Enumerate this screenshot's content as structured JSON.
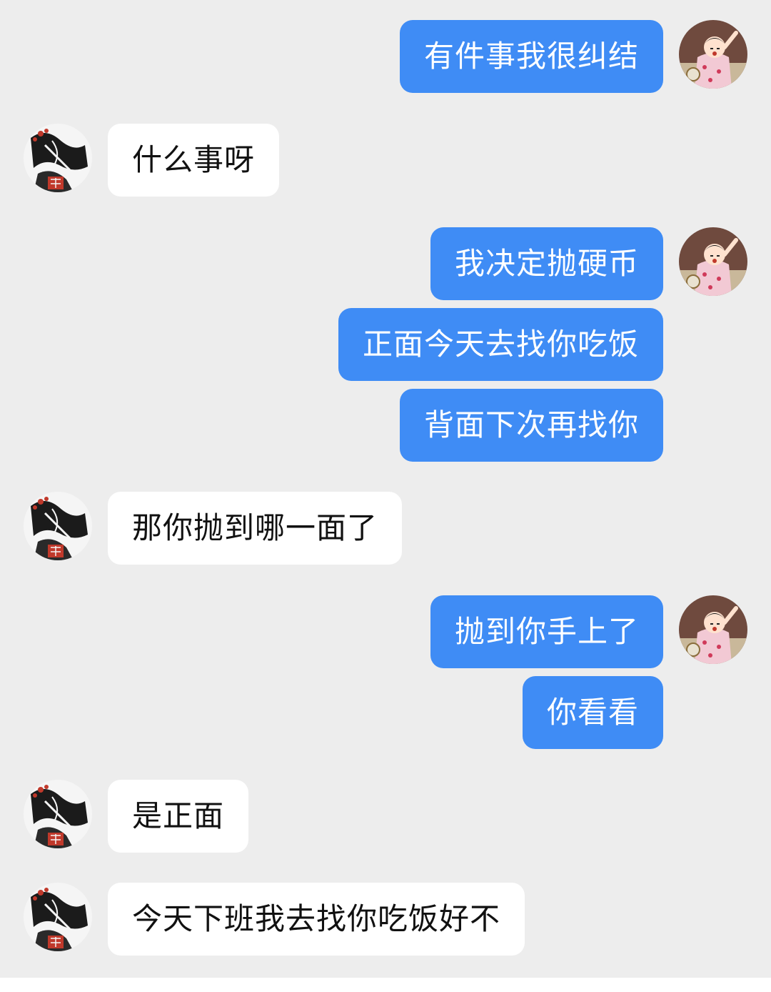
{
  "conversation": {
    "messages": [
      {
        "side": "out",
        "text": "有件事我很纠结"
      },
      {
        "side": "in",
        "text": "什么事呀"
      },
      {
        "side": "out",
        "text": "我决定抛硬币"
      },
      {
        "side": "out",
        "text": "正面今天去找你吃饭"
      },
      {
        "side": "out",
        "text": "背面下次再找你"
      },
      {
        "side": "in",
        "text": "那你抛到哪一面了"
      },
      {
        "side": "out",
        "text": "抛到你手上了"
      },
      {
        "side": "out",
        "text": "你看看"
      },
      {
        "side": "in",
        "text": "是正面"
      },
      {
        "side": "in",
        "text": "今天下班我去找你吃饭好不"
      }
    ]
  },
  "colors": {
    "background": "#ededed",
    "outgoing_bubble": "#3f8cf5",
    "incoming_bubble": "#ffffff"
  },
  "avatars": {
    "me": "cartoon-kid-avatar",
    "them": "ink-painting-avatar"
  }
}
